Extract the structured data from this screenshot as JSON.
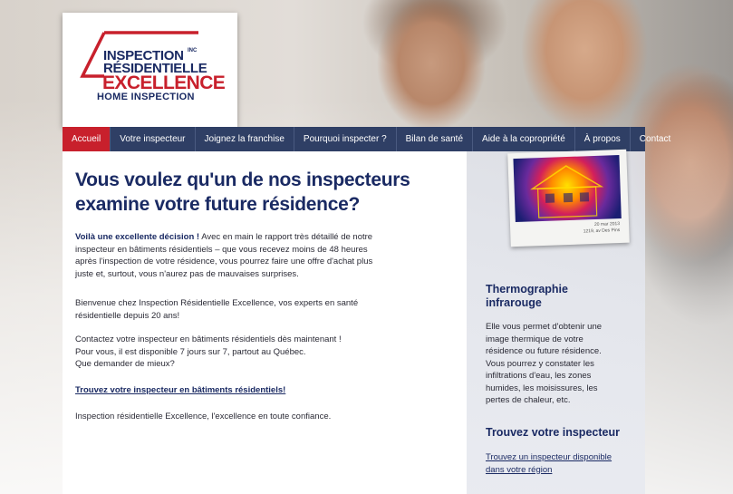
{
  "logo": {
    "line1": "INSPECTION",
    "mc": "INC",
    "line2": "RÉSIDENTIELLE",
    "line3": "EXCELLENCE",
    "line4": "HOME INSPECTION"
  },
  "nav": {
    "items": [
      {
        "label": "Accueil",
        "active": true
      },
      {
        "label": "Votre inspecteur"
      },
      {
        "label": "Joignez la franchise"
      },
      {
        "label": "Pourquoi inspecter ?"
      },
      {
        "label": "Bilan de santé"
      },
      {
        "label": "Aide à la copropriété"
      },
      {
        "label": "À propos"
      },
      {
        "label": "Contact"
      }
    ]
  },
  "main": {
    "title": "Vous voulez qu'un de nos inspecteurs examine votre future résidence?",
    "intro_strong": "Voilà une excellente décision !",
    "intro_rest": " Avec en main le rapport très détaillé de notre inspecteur en bâtiments résidentiels – que vous recevez moins de 48 heures après l'inspection de votre résidence, vous pourrez faire une offre d'achat plus juste et, surtout, vous n'aurez pas de mauvaises surprises.",
    "welcome": "Bienvenue chez Inspection Résidentielle Excellence, vos experts en santé résidentielle depuis 20 ans!",
    "contact1": "Contactez votre inspecteur en bâtiments résidentiels dès maintenant !",
    "contact2": "Pour vous, il est disponible 7 jours sur 7, partout au Québec.",
    "contact3": "Que demander de mieux?",
    "find_link": "Trouvez votre inspecteur en bâtiments résidentiels!",
    "tagline": "Inspection résidentielle Excellence, l'excellence en toute confiance."
  },
  "sidebar": {
    "polaroid_caption1": "20 mar 2013",
    "polaroid_caption2": "1219, av Des Pins",
    "thermo_title": "Thermographie infrarouge",
    "thermo_text": "Elle vous permet d'obtenir une image thermique de votre résidence ou future résidence. Vous pourrez y constater les infiltrations d'eau, les zones humides, les moisissures, les pertes de chaleur, etc.",
    "find_title": "Trouvez votre inspecteur",
    "find_link": "Trouvez un inspecteur disponible dans votre région"
  },
  "colors": {
    "brand_navy": "#1a2a63",
    "brand_red": "#c8202c",
    "nav_bg": "#2f3f65"
  }
}
